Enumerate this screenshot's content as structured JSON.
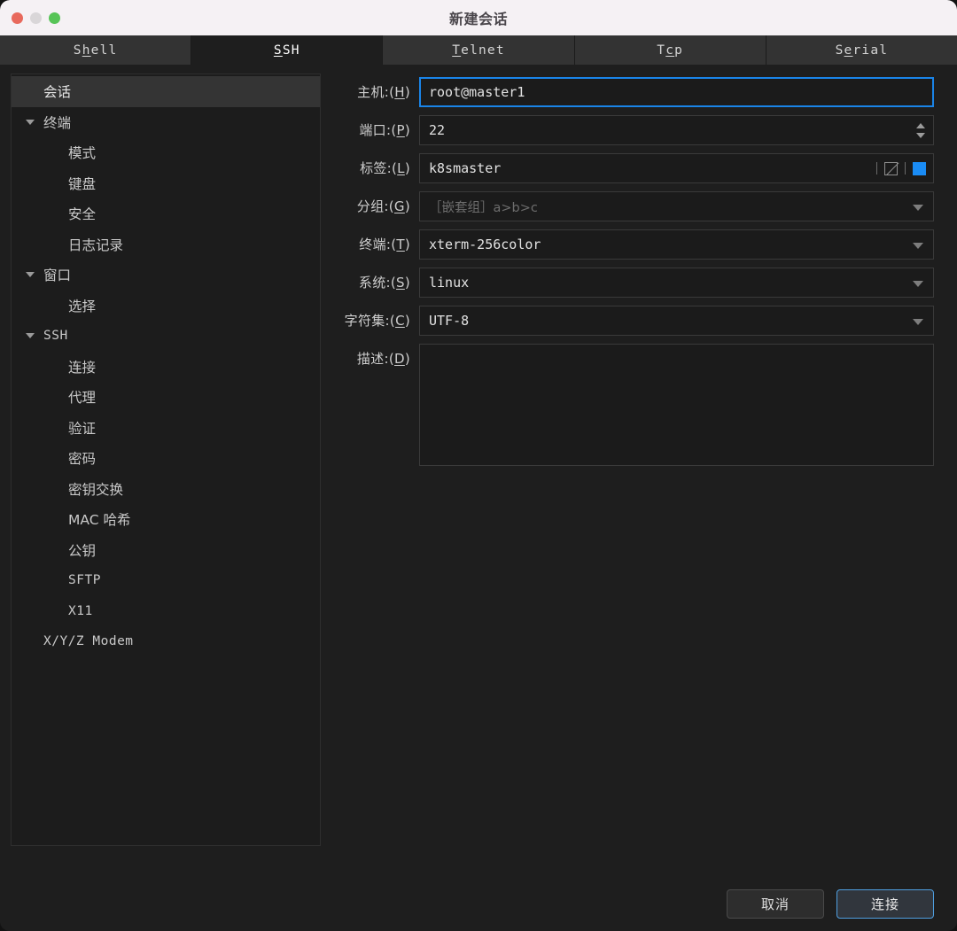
{
  "window": {
    "title": "新建会话",
    "controls": {
      "close": "close-button",
      "minimize": "minimize-button",
      "zoom": "zoom-button"
    }
  },
  "tabs": [
    {
      "label": "Shell",
      "mnemonic_index": 1,
      "active": false
    },
    {
      "label": "SSH",
      "mnemonic_index": 0,
      "active": true
    },
    {
      "label": "Telnet",
      "mnemonic_index": 0,
      "active": false
    },
    {
      "label": "Tcp",
      "mnemonic_index": 1,
      "active": false
    },
    {
      "label": "Serial",
      "mnemonic_index": 1,
      "active": false
    }
  ],
  "sidebar": {
    "items": [
      {
        "label": "会话",
        "level": 0,
        "expandable": false,
        "selected": true,
        "mono": false
      },
      {
        "label": "终端",
        "level": 0,
        "expandable": true,
        "selected": false,
        "mono": false
      },
      {
        "label": "模式",
        "level": 1,
        "expandable": false,
        "selected": false,
        "mono": false
      },
      {
        "label": "键盘",
        "level": 1,
        "expandable": false,
        "selected": false,
        "mono": false
      },
      {
        "label": "安全",
        "level": 1,
        "expandable": false,
        "selected": false,
        "mono": false
      },
      {
        "label": "日志记录",
        "level": 1,
        "expandable": false,
        "selected": false,
        "mono": false
      },
      {
        "label": "窗口",
        "level": 0,
        "expandable": true,
        "selected": false,
        "mono": false
      },
      {
        "label": "选择",
        "level": 1,
        "expandable": false,
        "selected": false,
        "mono": false
      },
      {
        "label": "SSH",
        "level": 0,
        "expandable": true,
        "selected": false,
        "mono": true
      },
      {
        "label": "连接",
        "level": 1,
        "expandable": false,
        "selected": false,
        "mono": false
      },
      {
        "label": "代理",
        "level": 1,
        "expandable": false,
        "selected": false,
        "mono": false
      },
      {
        "label": "验证",
        "level": 1,
        "expandable": false,
        "selected": false,
        "mono": false
      },
      {
        "label": "密码",
        "level": 1,
        "expandable": false,
        "selected": false,
        "mono": false
      },
      {
        "label": "密钥交换",
        "level": 1,
        "expandable": false,
        "selected": false,
        "mono": false
      },
      {
        "label": "MAC 哈希",
        "level": 1,
        "expandable": false,
        "selected": false,
        "mono": false
      },
      {
        "label": "公钥",
        "level": 1,
        "expandable": false,
        "selected": false,
        "mono": false
      },
      {
        "label": "SFTP",
        "level": 1,
        "expandable": false,
        "selected": false,
        "mono": true
      },
      {
        "label": "X11",
        "level": 1,
        "expandable": false,
        "selected": false,
        "mono": true
      },
      {
        "label": "X/Y/Z Modem",
        "level": 0,
        "expandable": false,
        "selected": false,
        "mono": true
      }
    ]
  },
  "form": {
    "host": {
      "label": "主机:(H)",
      "mnemonic": "H",
      "value": "root@master1",
      "focused": true
    },
    "port": {
      "label": "端口:(P)",
      "mnemonic": "P",
      "value": "22"
    },
    "tag": {
      "label": "标签:(L)",
      "mnemonic": "L",
      "value": "k8smaster",
      "none_color_icon": "no-color-swatch-icon",
      "color": "#1a8cf5"
    },
    "group": {
      "label": "分组:(G)",
      "mnemonic": "G",
      "value": "",
      "placeholder": "［嵌套组］a>b>c"
    },
    "terminal": {
      "label": "终端:(T)",
      "mnemonic": "T",
      "value": "xterm-256color"
    },
    "system": {
      "label": "系统:(S)",
      "mnemonic": "S",
      "value": "linux"
    },
    "charset": {
      "label": "字符集:(C)",
      "mnemonic": "C",
      "value": "UTF-8"
    },
    "description": {
      "label": "描述:(D)",
      "mnemonic": "D",
      "value": ""
    }
  },
  "footer": {
    "cancel": "取消",
    "connect": "连接"
  },
  "colors": {
    "accent": "#1a8cf5",
    "default_button_border": "#4f9fe0",
    "window_bg": "#1e1e1e",
    "titlebar_bg": "#f5f1f4"
  }
}
